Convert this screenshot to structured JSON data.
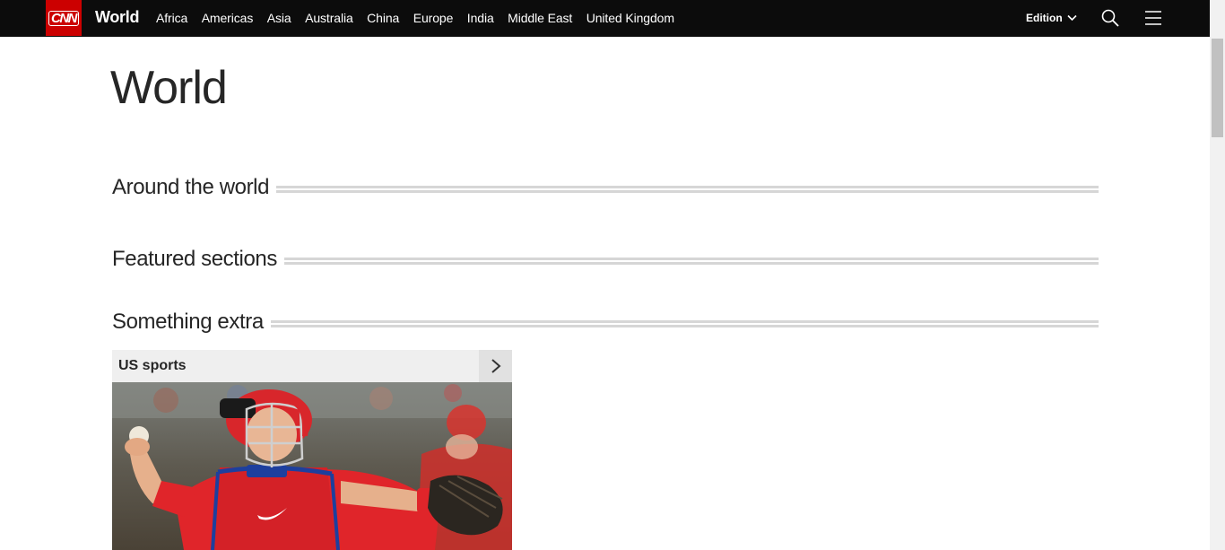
{
  "header": {
    "logo_text": "CNN",
    "section": "World",
    "nav": [
      "Africa",
      "Americas",
      "Asia",
      "Australia",
      "China",
      "Europe",
      "India",
      "Middle East",
      "United Kingdom"
    ],
    "edition_label": "Edition",
    "icons": {
      "search": "search-icon",
      "menu": "hamburger-menu-icon",
      "edition": "chevron-down-icon"
    }
  },
  "page": {
    "title": "World",
    "zones": [
      "Around the world",
      "Featured sections",
      "Something extra"
    ]
  },
  "card": {
    "label": "US sports",
    "arrow_icon": "chevron-right-icon",
    "image_alt": "Baseball catcher in red gear throwing a ball"
  },
  "colors": {
    "brand_red": "#cc0000",
    "nav_bg": "#0c0c0c"
  }
}
